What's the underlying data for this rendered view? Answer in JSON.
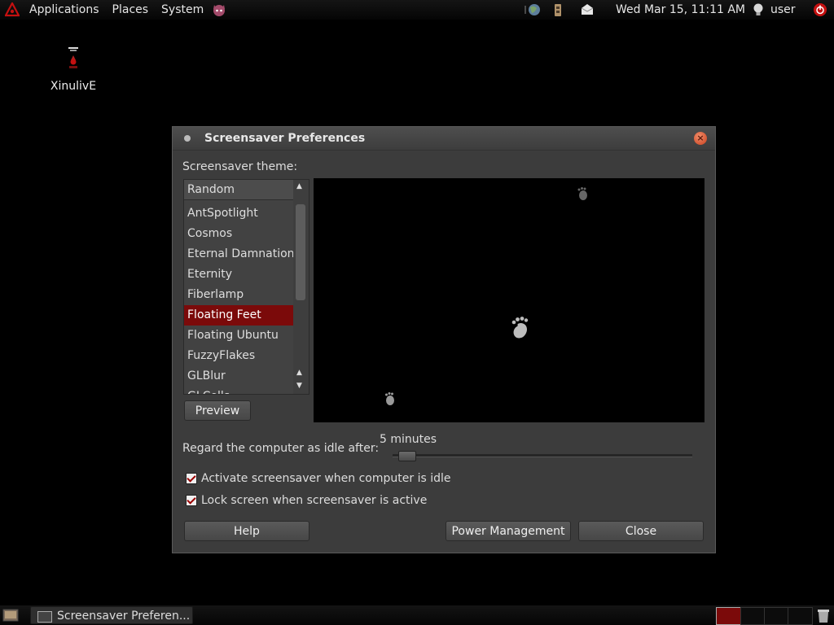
{
  "top_panel": {
    "menus": [
      "Applications",
      "Places",
      "System"
    ],
    "clock": "Wed Mar 15, 11:11 AM",
    "user": "user"
  },
  "desktop": {
    "icon_label": "XinulivE"
  },
  "dialog": {
    "title": "Screensaver Preferences",
    "theme_label": "Screensaver theme:",
    "themes": [
      "Random",
      "AntSpotlight",
      "Cosmos",
      "Eternal Damnation",
      "Eternity",
      "Fiberlamp",
      "Floating Feet",
      "Floating Ubuntu",
      "FuzzyFlakes",
      "GLBlur",
      "GLCells"
    ],
    "selected_theme": "Floating Feet",
    "preview_button": "Preview",
    "idle_label": "Regard the computer as idle after:",
    "idle_value": "5 minutes",
    "idle_level_fraction": 0.02,
    "activate_label": "Activate screensaver when computer is idle",
    "activate_checked": true,
    "lock_label": "Lock screen when screensaver is active",
    "lock_checked": true,
    "help_button": "Help",
    "power_button": "Power Management",
    "close_button": "Close"
  },
  "bottom_panel": {
    "task_label": "Screensaver Preferen..."
  },
  "colors": {
    "selection": "#7b0a0a",
    "accent_red": "#c00000"
  }
}
